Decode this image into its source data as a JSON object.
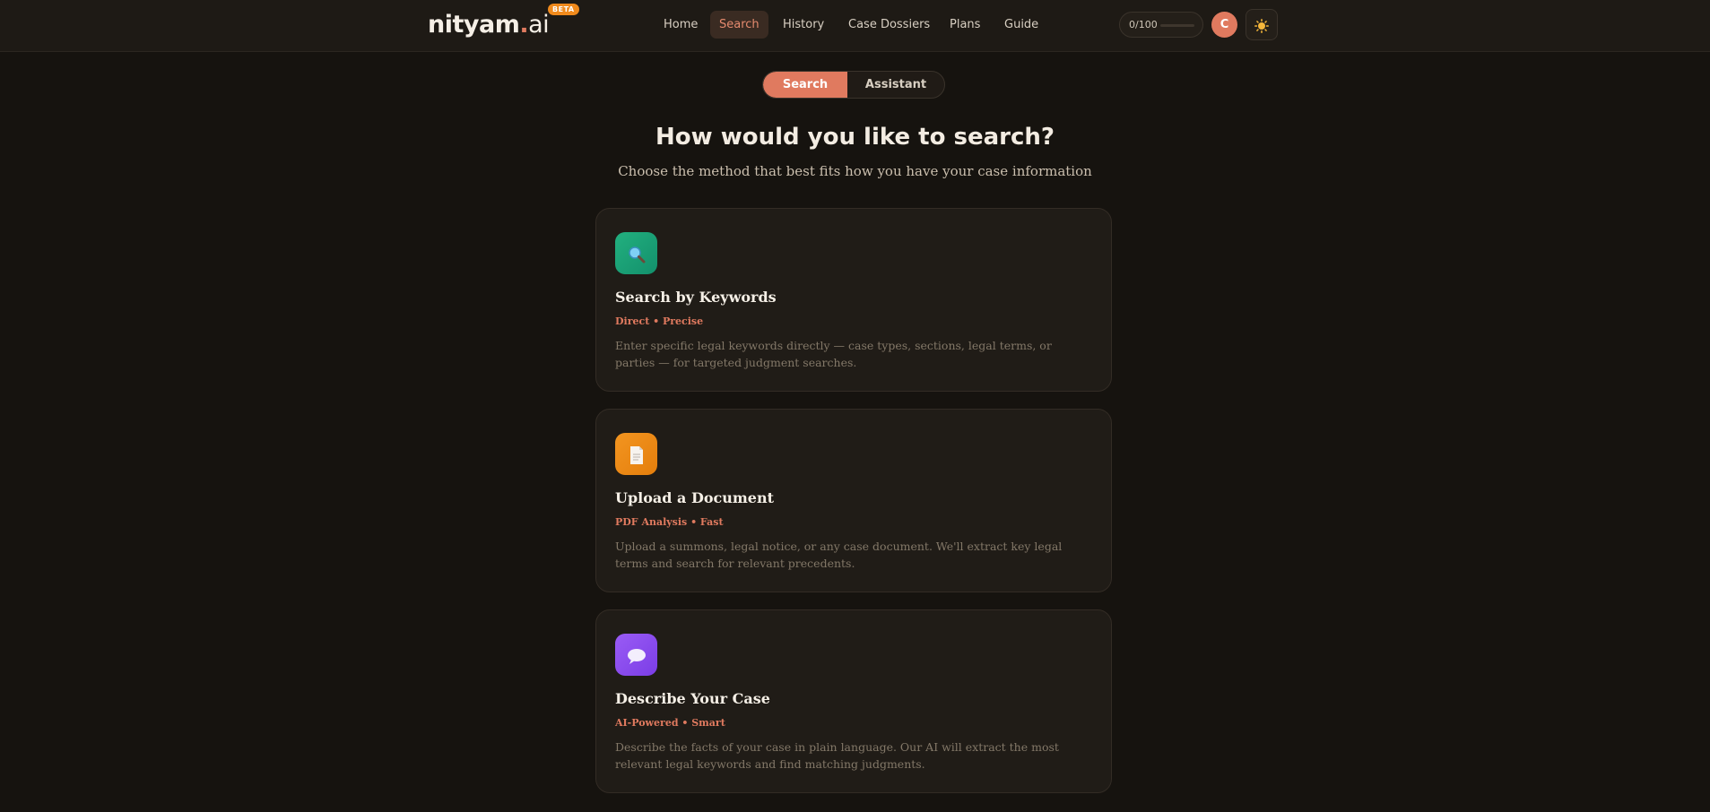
{
  "header": {
    "logo_main": "nityam",
    "logo_dot": ".",
    "logo_suffix": "ai",
    "beta_badge": "BETA",
    "nav": [
      {
        "label": "Home",
        "active": false
      },
      {
        "label": "Search",
        "active": true
      },
      {
        "label": "History",
        "active": false
      },
      {
        "label": "Case Dossiers",
        "active": false
      },
      {
        "label": "Plans",
        "active": false
      },
      {
        "label": "Guide",
        "active": false
      }
    ],
    "quota_text": "0/100",
    "quota_fraction": 0.0,
    "avatar_initial": "C",
    "theme_icon": "sun-icon"
  },
  "mode_toggle": {
    "options": [
      {
        "label": "Search",
        "active": true
      },
      {
        "label": "Assistant",
        "active": false
      }
    ]
  },
  "main": {
    "title": "How would you like to search?",
    "subtitle": "Choose the method that best fits how you have your case information",
    "cards": [
      {
        "icon": "magnifier-icon",
        "icon_color": "#1fa37a",
        "title": "Search by Keywords",
        "tag": "Direct • Precise",
        "description": "Enter specific legal keywords directly — case types, sections, legal terms, or parties — for targeted judgment searches."
      },
      {
        "icon": "document-icon",
        "icon_color": "#ef8a14",
        "title": "Upload a Document",
        "tag": "PDF Analysis • Fast",
        "description": "Upload a summons, legal notice, or any case document. We'll extract key legal terms and search for relevant precedents."
      },
      {
        "icon": "speech-bubble-icon",
        "icon_color": "#8b4cf0",
        "title": "Describe Your Case",
        "tag": "AI-Powered • Smart",
        "description": "Describe the facts of your case in plain language. Our AI will extract the most relevant legal keywords and find matching judgments."
      }
    ]
  },
  "colors": {
    "accent": "#e07a5f",
    "background": "#16130f",
    "card": "#201c17"
  }
}
